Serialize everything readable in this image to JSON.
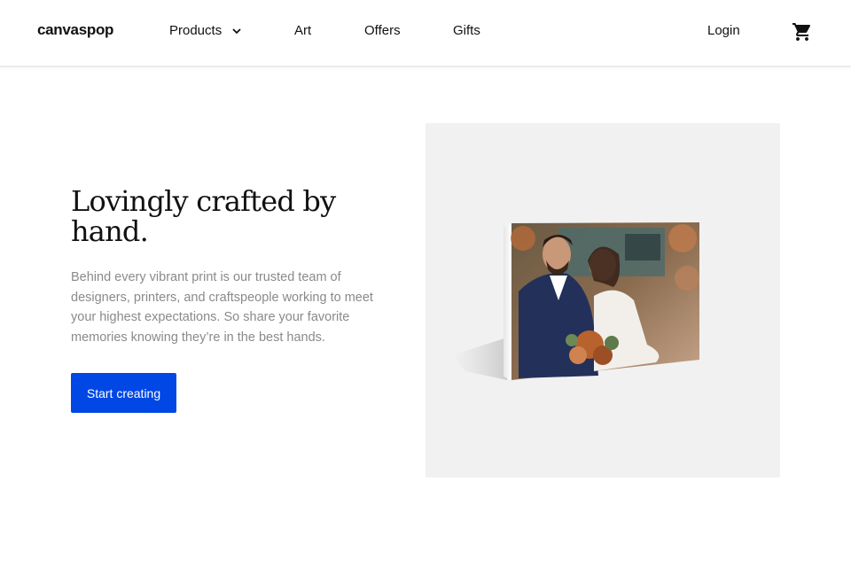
{
  "header": {
    "logo": "canvaspop",
    "nav": {
      "products": "Products",
      "art": "Art",
      "offers": "Offers",
      "gifts": "Gifts"
    },
    "login": "Login",
    "icons": {
      "dropdown": "chevron-down-icon",
      "cart": "shopping-cart-icon"
    }
  },
  "hero": {
    "headline": "Lovingly crafted by hand.",
    "body": "Behind every vibrant print is our trusted team of designers, printers, and craftspeople working to meet your highest expectations. So share your favorite memories knowing they’re in the best hands.",
    "cta": "Start creating"
  },
  "colors": {
    "accent": "#0047e6",
    "panel_bg": "#f1f1f1",
    "body_text": "#8a8a8a"
  }
}
